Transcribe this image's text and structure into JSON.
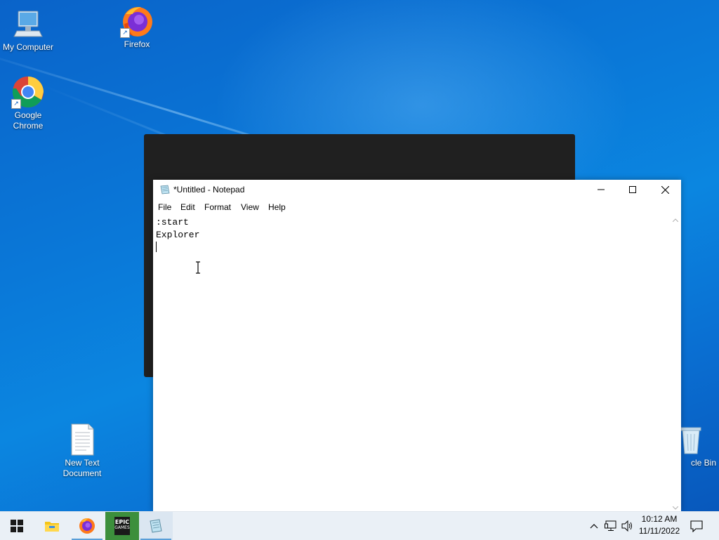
{
  "desktop": {
    "icons": [
      {
        "label": "My Computer"
      },
      {
        "label": "Firefox"
      },
      {
        "label_line1": "Google",
        "label_line2": "Chrome"
      },
      {
        "label_line1": "New Text",
        "label_line2": "Document"
      },
      {
        "label": "cle Bin"
      }
    ]
  },
  "notepad": {
    "title": "*Untitled - Notepad",
    "menu": [
      "File",
      "Edit",
      "Format",
      "View",
      "Help"
    ],
    "content_lines": [
      ":start",
      "Explorer",
      ""
    ]
  },
  "taskbar": {
    "items": [
      "start-button",
      "file-explorer",
      "firefox",
      "epic-games",
      "notepad"
    ],
    "epic_label_line1": "EPIC",
    "epic_label_line2": "GAMES",
    "time": "10:12 AM",
    "date": "11/11/2022"
  },
  "colors": {
    "desktop_blue": "#0a78d8",
    "taskbar_bg": "#eaf0f6",
    "active_underline": "#5a9fd8",
    "dark_window": "#202020"
  }
}
